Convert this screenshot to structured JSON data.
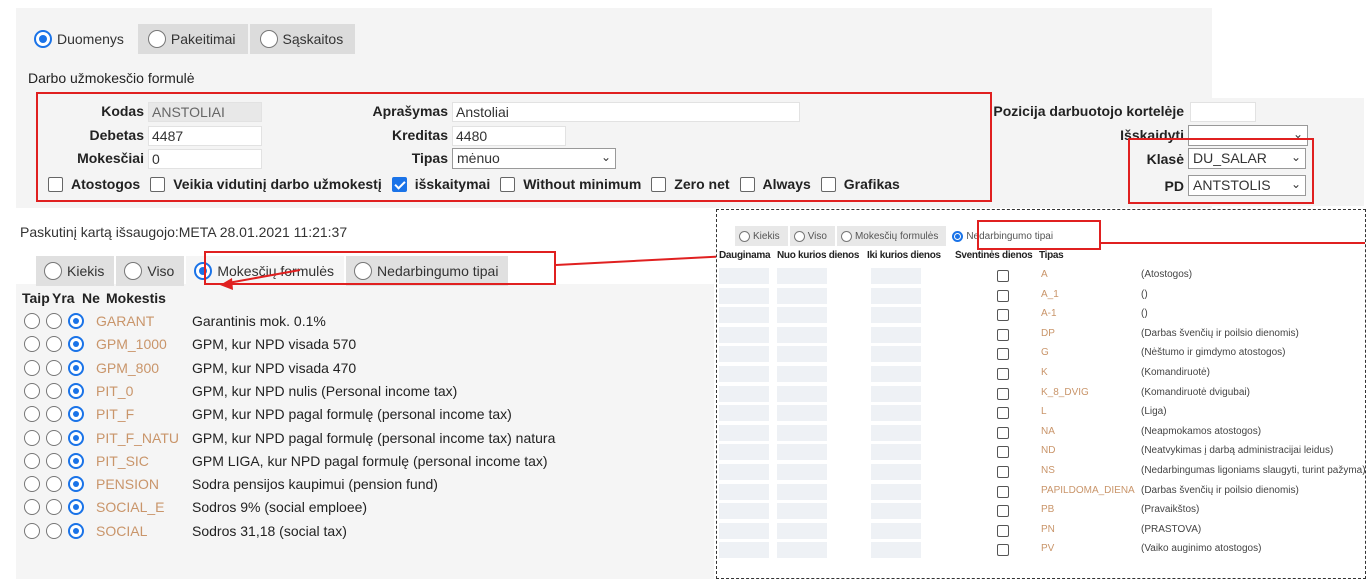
{
  "tabs": [
    {
      "label": "Duomenys",
      "selected": true
    },
    {
      "label": "Pakeitimai",
      "selected": false
    },
    {
      "label": "Sąskaitos",
      "selected": false
    }
  ],
  "form_title": "Darbo užmokesčio formulė",
  "fields": {
    "kodas": {
      "label": "Kodas",
      "value": "ANSTOLIAI"
    },
    "debetas": {
      "label": "Debetas",
      "value": "4487"
    },
    "mokesciai": {
      "label": "Mokesčiai",
      "value": "0"
    },
    "aprasymas": {
      "label": "Aprašymas",
      "value": "Anstoliai"
    },
    "kreditas": {
      "label": "Kreditas",
      "value": "4480"
    },
    "tipas": {
      "label": "Tipas",
      "value": "mėnuo"
    },
    "pozicija": {
      "label": "Pozicija darbuotojo kortelėje",
      "value": ""
    },
    "isskaidyti": {
      "label": "Išskaidyti",
      "value": ""
    },
    "klase": {
      "label": "Klasė",
      "value": "DU_SALAR"
    },
    "pd": {
      "label": "PD",
      "value": "ANTSTOLIS"
    }
  },
  "checkboxes": [
    {
      "label": "Atostogos",
      "checked": false
    },
    {
      "label": "Veikia vidutinį darbo užmokestį",
      "checked": false
    },
    {
      "label": "išskaitymai",
      "checked": true
    },
    {
      "label": "Without minimum",
      "checked": false
    },
    {
      "label": "Zero net",
      "checked": false
    },
    {
      "label": "Always",
      "checked": false
    },
    {
      "label": "Grafikas",
      "checked": false
    }
  ],
  "saved_text": "Paskutinį kartą išsaugojo:META 28.01.2021 11:21:37",
  "sub_tabs": [
    {
      "label": "Kiekis",
      "selected": false
    },
    {
      "label": "Viso",
      "selected": false
    },
    {
      "label": "Mokesčių formulės",
      "selected": true
    },
    {
      "label": "Nedarbingumo tipai",
      "selected": false
    }
  ],
  "mokestis_headers": [
    "Taip",
    "Yra",
    "Ne",
    "Mokestis"
  ],
  "mokestis_rows": [
    {
      "code": "GARANT",
      "desc": "Garantinis mok. 0.1%"
    },
    {
      "code": "GPM_1000",
      "desc": "GPM, kur NPD visada 570"
    },
    {
      "code": "GPM_800",
      "desc": "GPM, kur NPD visada 470"
    },
    {
      "code": "PIT_0",
      "desc": "GPM, kur NPD nulis (Personal income tax)"
    },
    {
      "code": "PIT_F",
      "desc": "GPM, kur NPD pagal formulę (personal income tax)"
    },
    {
      "code": "PIT_F_NATU",
      "desc": "GPM, kur NPD pagal formulę (personal income tax) natura"
    },
    {
      "code": "PIT_SIC",
      "desc": "GPM LIGA, kur NPD pagal formulę (personal income tax)"
    },
    {
      "code": "PENSION",
      "desc": "Sodra pensijos kaupimui (pension fund)"
    },
    {
      "code": "SOCIAL_E",
      "desc": "Sodros 9% (social emploee)"
    },
    {
      "code": "SOCIAL",
      "desc": "Sodros 31,18 (social tax)"
    }
  ],
  "popup": {
    "tabs": [
      {
        "label": "Kiekis",
        "selected": false
      },
      {
        "label": "Viso",
        "selected": false
      },
      {
        "label": "Mokesčių formulės",
        "selected": false
      },
      {
        "label": "Nedarbingumo tipai",
        "selected": true
      }
    ],
    "headers": [
      "Dauginama",
      "Nuo kurios dienos",
      "Iki kurios dienos",
      "Šventinės dienos",
      "Tipas"
    ],
    "rows": [
      {
        "code": "A",
        "desc": "(Atostogos)"
      },
      {
        "code": "A_1",
        "desc": "()"
      },
      {
        "code": "A-1",
        "desc": "()"
      },
      {
        "code": "DP",
        "desc": "(Darbas švenčių ir poilsio dienomis)"
      },
      {
        "code": "G",
        "desc": "(Nėštumo ir gimdymo atostogos)"
      },
      {
        "code": "K",
        "desc": "(Komandiruotė)"
      },
      {
        "code": "K_8_DVIG",
        "desc": "(Komandiruotė dvigubai)"
      },
      {
        "code": "L",
        "desc": "(Liga)"
      },
      {
        "code": "NA",
        "desc": "(Neapmokamos atostogos)"
      },
      {
        "code": "ND",
        "desc": "(Neatvykimas į darbą administracijai leidus)"
      },
      {
        "code": "NS",
        "desc": "(Nedarbingumas ligoniams slaugyti, turint pažyma)"
      },
      {
        "code": "PAPILDOMA_DIENA",
        "desc": "(Darbas švenčių ir poilsio dienomis)"
      },
      {
        "code": "PB",
        "desc": "(Pravaikštos)"
      },
      {
        "code": "PN",
        "desc": "(PRASTOVA)"
      },
      {
        "code": "PV",
        "desc": "(Vaiko auginimo atostogos)"
      }
    ]
  },
  "colors": {
    "accent": "#1a73e8",
    "highlight": "#e02020",
    "code_text": "#c9956a"
  }
}
